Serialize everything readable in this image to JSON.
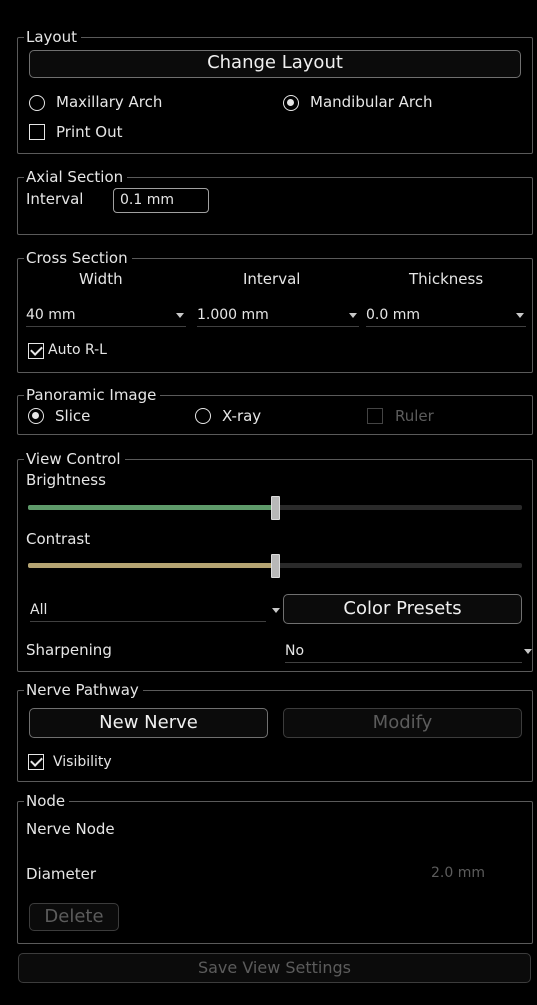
{
  "layout": {
    "title": "Layout",
    "change_layout": "Change Layout",
    "maxillary": "Maxillary Arch",
    "mandibular": "Mandibular Arch",
    "print_out": "Print Out"
  },
  "axial": {
    "title": "Axial Section",
    "interval_label": "Interval",
    "interval_value": "0.1 mm"
  },
  "cross": {
    "title": "Cross Section",
    "width_label": "Width",
    "interval_label": "Interval",
    "thickness_label": "Thickness",
    "width_value": "40 mm",
    "interval_value": "1.000 mm",
    "thickness_value": "0.0 mm",
    "auto_rl": "Auto R-L"
  },
  "panoramic": {
    "title": "Panoramic Image",
    "slice": "Slice",
    "xray": "X-ray",
    "ruler": "Ruler"
  },
  "view": {
    "title": "View Control",
    "brightness": "Brightness",
    "brightness_level": 0.5,
    "contrast": "Contrast",
    "contrast_level": 0.5,
    "filter_value": "All",
    "color_presets": "Color Presets",
    "sharpening": "Sharpening",
    "sharpening_value": "No",
    "colors": {
      "brightness": "#5e9a6a",
      "contrast": "#b5a472"
    }
  },
  "nerve": {
    "title": "Nerve Pathway",
    "new_nerve": "New Nerve",
    "modify": "Modify",
    "visibility": "Visibility"
  },
  "node": {
    "title": "Node",
    "nerve_node": "Nerve Node",
    "diameter": "Diameter",
    "diameter_value": "2.0 mm",
    "delete": "Delete"
  },
  "footer": {
    "save": "Save View Settings"
  }
}
